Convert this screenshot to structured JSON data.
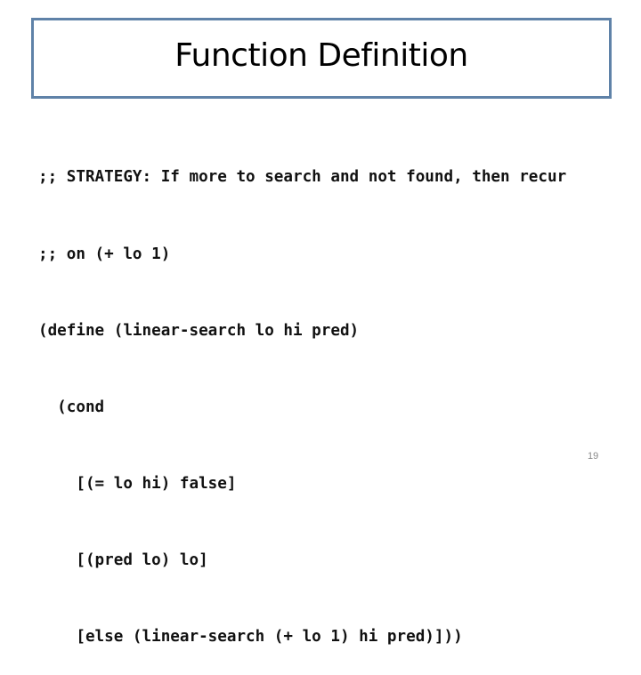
{
  "slide": {
    "title": "Function Definition",
    "code_lines": [
      ";; STRATEGY: If more to search and not found, then recur",
      ";; on (+ lo 1)",
      "(define (linear-search lo hi pred)",
      "  (cond",
      "    [(= lo hi) false]",
      "    [(pred lo) lo]",
      "    [else (linear-search (+ lo 1) hi pred)]))"
    ],
    "page_number": "19"
  },
  "colors": {
    "title_border": "#5f82a8",
    "text": "#111111",
    "page_number": "#8a8a8a"
  }
}
